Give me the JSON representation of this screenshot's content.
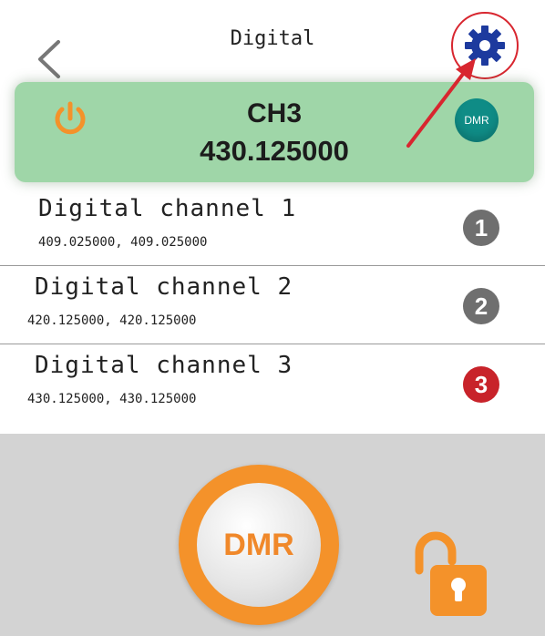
{
  "header": {
    "title": "Digital",
    "back_icon": "chevron-left-icon",
    "settings_icon": "gear-icon"
  },
  "current": {
    "channel": "CH3",
    "frequency": "430.125000",
    "mode_badge": "DMR",
    "power_icon": "power-icon"
  },
  "channels": [
    {
      "name": "Digital channel 1",
      "freqs": "409.025000, 409.025000",
      "number": "1",
      "active": false
    },
    {
      "name": "Digital channel 2",
      "freqs": "420.125000, 420.125000",
      "number": "2",
      "active": false
    },
    {
      "name": "Digital channel 3",
      "freqs": "430.125000, 430.125000",
      "number": "3",
      "active": true
    }
  ],
  "bottom": {
    "mode_button": "DMR",
    "lock_icon": "unlock-icon"
  },
  "colors": {
    "accent": "#f4922a",
    "card": "#9fd6a8",
    "active_badge": "#c8232a",
    "highlight": "#d8262f",
    "gear": "#1d3a9e"
  }
}
